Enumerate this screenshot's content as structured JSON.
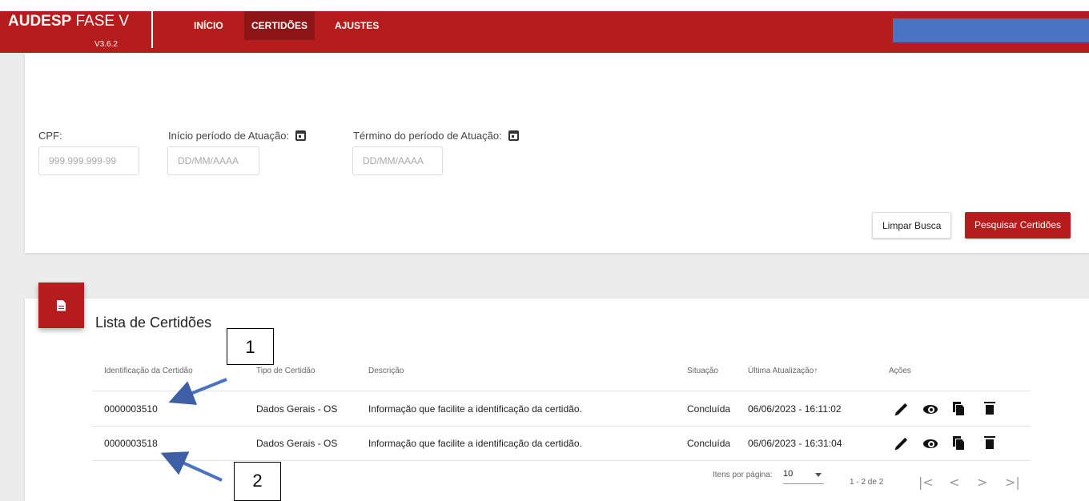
{
  "header": {
    "brand_bold": "AUDESP",
    "brand_rest": " FASE V",
    "version": "V3.6.2",
    "nav": [
      {
        "label": "INÍCIO",
        "active": false
      },
      {
        "label": "CERTIDÕES",
        "active": true
      },
      {
        "label": "AJUSTES",
        "active": false
      }
    ],
    "accent_color": "#b71c1c"
  },
  "search": {
    "cpf_label": "CPF:",
    "cpf_placeholder": "999.999.999-99",
    "start_label": "Início período de Atuação:",
    "start_placeholder": "DD/MM/AAAA",
    "end_label": "Término do período de Atuação:",
    "end_placeholder": "DD/MM/AAAA",
    "clear_button": "Limpar Busca",
    "search_button": "Pesquisar Certidões"
  },
  "list": {
    "title": "Lista de Certidões",
    "columns": [
      "Identificação da Certidão",
      "Tipo de Certidão",
      "Descrição",
      "Situação",
      "Última Atualização↑",
      "Ações"
    ],
    "rows": [
      {
        "id": "0000003510",
        "type": "Dados Gerais - OS",
        "description": "Informação que facilite a identificação da certidão.",
        "status": "Concluída",
        "updated": "06/06/2023 - 16:11:02"
      },
      {
        "id": "0000003518",
        "type": "Dados Gerais - OS",
        "description": "Informação que facilite a identificação da certidão.",
        "status": "Concluída",
        "updated": "06/06/2023 - 16:31:04"
      }
    ],
    "actions": [
      "edit-icon",
      "view-icon",
      "copy-icon",
      "delete-icon"
    ]
  },
  "pagination": {
    "items_per_page_label": "Itens por página:",
    "items_per_page": "10",
    "range": "1 - 2 de 2",
    "first": "|<",
    "prev": "<",
    "next": ">",
    "last": ">|"
  },
  "annotations": [
    {
      "label": "1"
    },
    {
      "label": "2"
    }
  ]
}
